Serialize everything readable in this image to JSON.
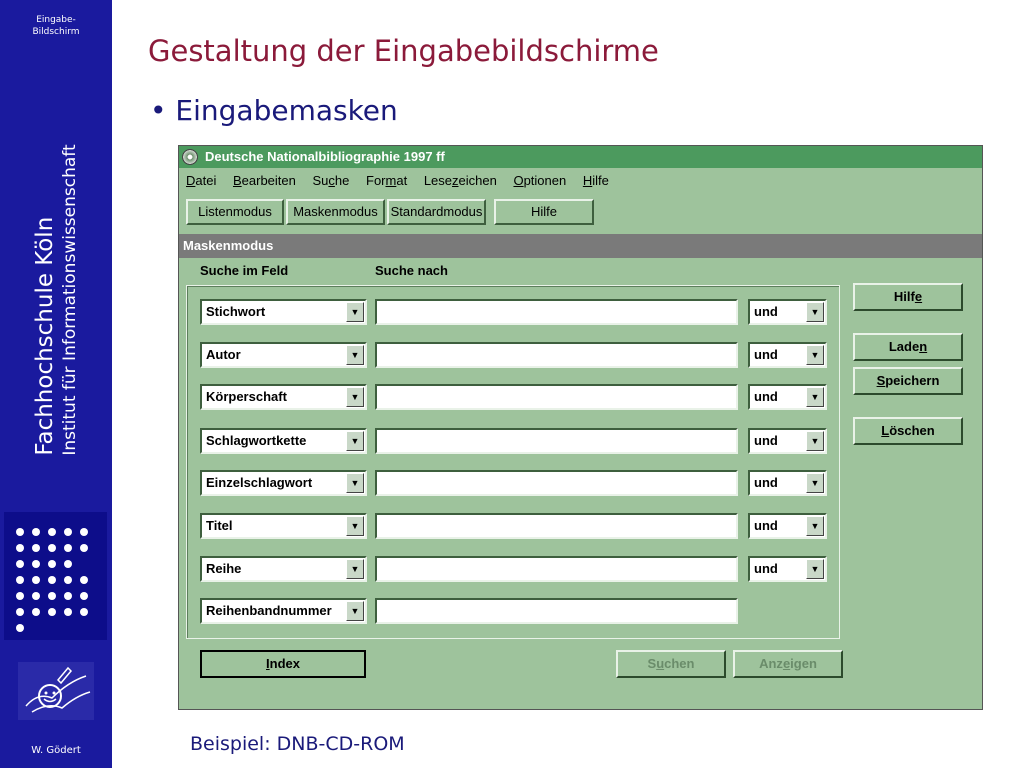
{
  "sidebar": {
    "top_label_line1": "Eingabe-",
    "top_label_line2": "Bildschirm",
    "institution": "Fachhochschule Köln",
    "institute": "Institut für Informationswissenschaft",
    "author": "W. Gödert"
  },
  "slide": {
    "title": "Gestaltung der Eingabebildschirme",
    "bullet": "• Eingabemasken",
    "caption": "Beispiel: DNB-CD-ROM"
  },
  "app": {
    "title": "Deutsche Nationalbibliographie 1997 ff",
    "menu": [
      {
        "pre": "",
        "u": "D",
        "post": "atei"
      },
      {
        "pre": "",
        "u": "B",
        "post": "earbeiten"
      },
      {
        "pre": "Su",
        "u": "c",
        "post": "he"
      },
      {
        "pre": "For",
        "u": "m",
        "post": "at"
      },
      {
        "pre": "Lese",
        "u": "z",
        "post": "eichen"
      },
      {
        "pre": "",
        "u": "O",
        "post": "ptionen"
      },
      {
        "pre": "",
        "u": "H",
        "post": "ilfe"
      }
    ],
    "toolbar": {
      "listenmodus": "Listenmodus",
      "maskenmodus": "Maskenmodus",
      "standardmodus": "Standardmodus",
      "hilfe": "Hilfe"
    },
    "mode_bar": "Maskenmodus",
    "col_field": "Suche im Feld",
    "col_query": "Suche nach",
    "rows": [
      {
        "field": "Stichwort",
        "op": "und"
      },
      {
        "field": "Autor",
        "op": "und"
      },
      {
        "field": "Körperschaft",
        "op": "und"
      },
      {
        "field": "Schlagwortkette",
        "op": "und"
      },
      {
        "field": "Einzelschlagwort",
        "op": "und"
      },
      {
        "field": "Titel",
        "op": "und"
      },
      {
        "field": "Reihe",
        "op": "und"
      },
      {
        "field": "Reihenbandnummer",
        "op": ""
      }
    ],
    "side_buttons": {
      "hilfe": {
        "pre": "Hilf",
        "u": "e",
        "post": ""
      },
      "laden": {
        "pre": "Lade",
        "u": "n",
        "post": ""
      },
      "speichern": {
        "pre": "",
        "u": "S",
        "post": "peichern"
      },
      "loeschen": {
        "pre": "",
        "u": "L",
        "post": "öschen"
      }
    },
    "bottom_buttons": {
      "index": {
        "pre": "",
        "u": "I",
        "post": "ndex"
      },
      "suchen": {
        "pre": "S",
        "u": "u",
        "post": "chen"
      },
      "anzeigen": {
        "pre": "Anz",
        "u": "e",
        "post": "igen"
      }
    },
    "arrow_glyph": "▼"
  }
}
